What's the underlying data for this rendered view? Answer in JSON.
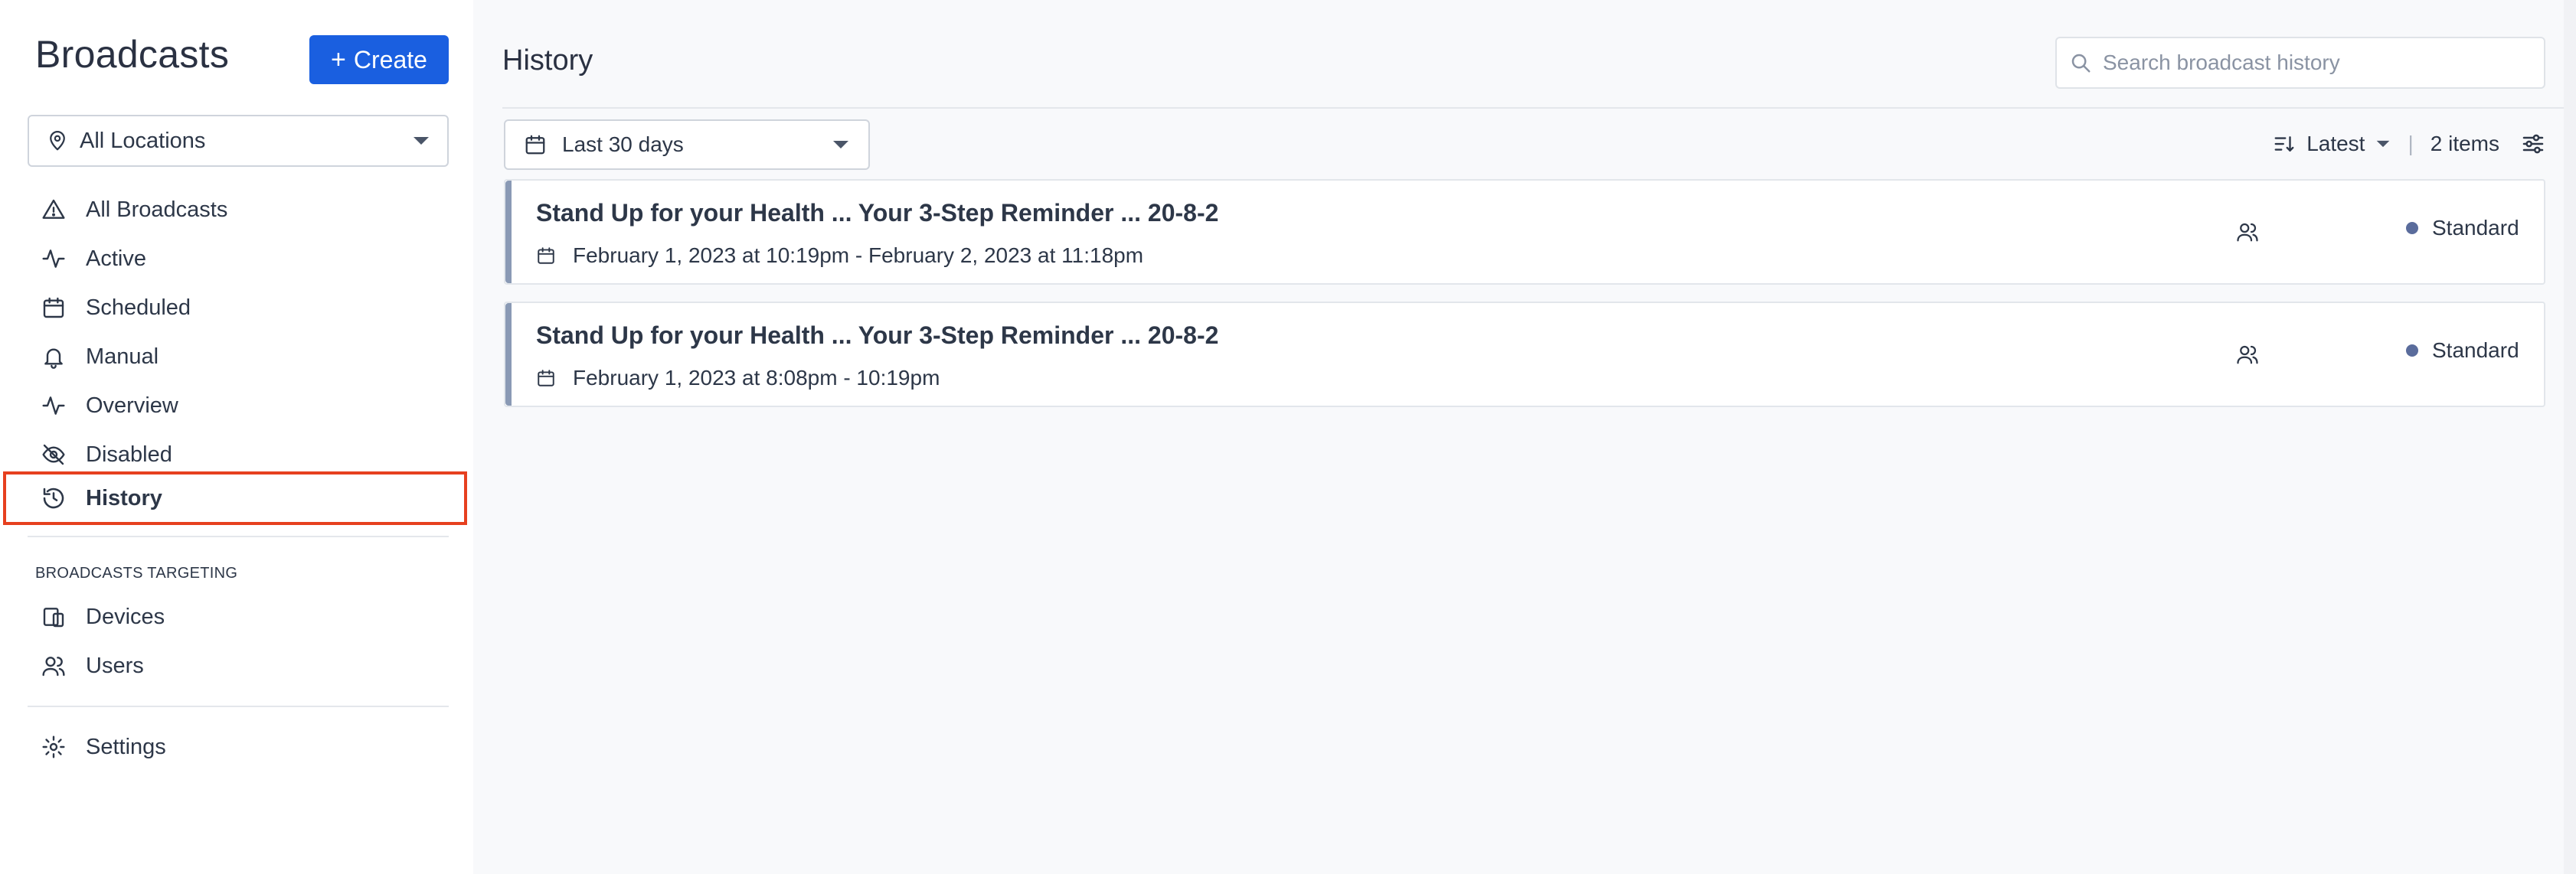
{
  "sidebar": {
    "title": "Broadcasts",
    "create_label": "Create",
    "location_select": "All Locations",
    "nav": [
      {
        "label": "All Broadcasts",
        "icon": "alert-triangle-icon"
      },
      {
        "label": "Active",
        "icon": "activity-icon"
      },
      {
        "label": "Scheduled",
        "icon": "calendar-icon"
      },
      {
        "label": "Manual",
        "icon": "bell-icon"
      },
      {
        "label": "Overview",
        "icon": "activity-icon"
      },
      {
        "label": "Disabled",
        "icon": "eye-off-icon"
      },
      {
        "label": "History",
        "icon": "history-icon",
        "selected": true
      }
    ],
    "section_label": "BROADCASTS TARGETING",
    "targeting": [
      {
        "label": "Devices",
        "icon": "devices-icon"
      },
      {
        "label": "Users",
        "icon": "users-icon"
      }
    ],
    "settings_label": "Settings"
  },
  "main": {
    "title": "History",
    "search_placeholder": "Search broadcast history",
    "date_filter": "Last 30 days",
    "sort_label": "Latest",
    "item_count": "2 items",
    "broadcasts": [
      {
        "title": "Stand Up for your Health ... Your 3-Step Reminder ... 20-8-2",
        "datetime": "February 1, 2023 at 10:19pm - February 2, 2023 at 11:18pm",
        "status": "Standard"
      },
      {
        "title": "Stand Up for your Health ... Your 3-Step Reminder ... 20-8-2",
        "datetime": "February 1, 2023 at 8:08pm - 10:19pm",
        "status": "Standard"
      }
    ]
  },
  "colors": {
    "accent": "#1a5fe0",
    "selected_outline": "#e6401f",
    "card_accent": "#8a9ab5",
    "status_dot": "#5a6c9c"
  }
}
